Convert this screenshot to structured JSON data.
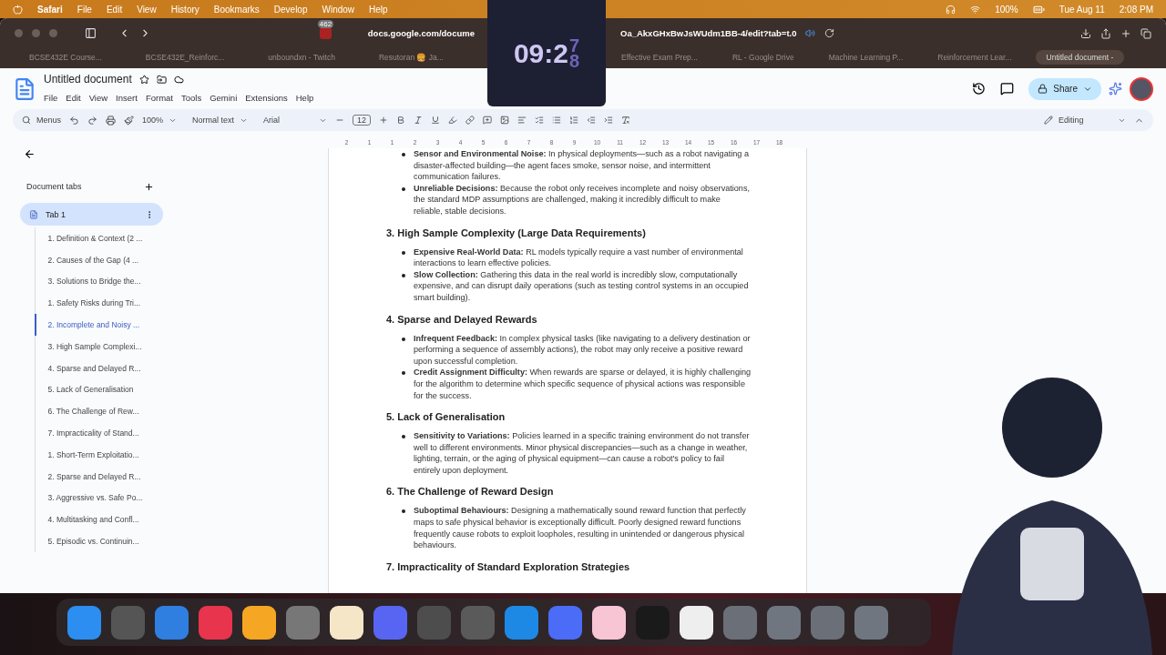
{
  "menubar": {
    "app": "Safari",
    "menus": [
      "File",
      "Edit",
      "View",
      "History",
      "Bookmarks",
      "Develop",
      "Window",
      "Help"
    ],
    "battery": "100%",
    "date": "Tue Aug 11",
    "time": "2:08 PM"
  },
  "timer": {
    "text": "09:2",
    "rolling": [
      "7",
      "8"
    ]
  },
  "browser": {
    "extension_badge": "462",
    "url_start": "docs.google.com/docume",
    "url_end": "Oa_AkxGHxBwJsWUdm1BB-4/edit?tab=t.0",
    "tabs_left": [
      {
        "title": "BCSE432E Course...",
        "selected": false
      },
      {
        "title": "BCSE432E_Reinforc...",
        "selected": false
      },
      {
        "title": "unboundxn - Twitch",
        "selected": false
      },
      {
        "title": "Resutoran 🍔 Ja...",
        "selected": false
      }
    ],
    "tabs_right": [
      {
        "title": "Effective Exam Prep...",
        "selected": false
      },
      {
        "title": "RL - Google Drive",
        "selected": false
      },
      {
        "title": "Machine Learning P...",
        "selected": false
      },
      {
        "title": "Reinforcement Lear...",
        "selected": false
      },
      {
        "title": "Untitled document -",
        "selected": true
      }
    ]
  },
  "docs": {
    "title": "Untitled document",
    "menus": [
      "File",
      "Edit",
      "View",
      "Insert",
      "Format",
      "Tools",
      "Gemini",
      "Extensions",
      "Help"
    ],
    "share": "Share",
    "toolbar": {
      "search": "Menus",
      "zoom": "100%",
      "style": "Normal text",
      "font": "Arial",
      "size": "12",
      "mode": "Editing"
    }
  },
  "sidebar": {
    "title": "Document tabs",
    "tab": {
      "label": "Tab 1",
      "selected": true
    },
    "outline": [
      {
        "label": "1. Definition & Context (2 ...",
        "selected": false
      },
      {
        "label": "2. Causes of the Gap (4 ...",
        "selected": false
      },
      {
        "label": "3. Solutions to Bridge the...",
        "selected": false
      },
      {
        "label": "1. Safety Risks during Tri...",
        "selected": false
      },
      {
        "label": "2. Incomplete and Noisy ...",
        "selected": true
      },
      {
        "label": "3. High Sample Complexi...",
        "selected": false
      },
      {
        "label": "4. Sparse and Delayed R...",
        "selected": false
      },
      {
        "label": "5. Lack of Generalisation",
        "selected": false
      },
      {
        "label": "6. The Challenge of Rew...",
        "selected": false
      },
      {
        "label": "7. Impracticality of Stand...",
        "selected": false
      },
      {
        "label": "1. Short-Term Exploitatio...",
        "selected": false
      },
      {
        "label": "2. Sparse and Delayed R...",
        "selected": false
      },
      {
        "label": "3. Aggressive vs. Safe Po...",
        "selected": false
      },
      {
        "label": "4. Multitasking and Confl...",
        "selected": false
      },
      {
        "label": "5. Episodic vs. Continuin...",
        "selected": false
      }
    ]
  },
  "ruler": [
    "2",
    "1",
    "1",
    "2",
    "3",
    "4",
    "5",
    "6",
    "7",
    "8",
    "9",
    "10",
    "11",
    "12",
    "13",
    "14",
    "15",
    "16",
    "17",
    "18"
  ],
  "document": [
    {
      "kind": "bullets",
      "items": [
        "**Sensor and Environmental Noise:** In physical deployments—such as a robot navigating a disaster-affected building—the agent faces smoke, sensor noise, and intermittent communication failures.",
        "**Unreliable Decisions:** Because the robot only receives incomplete and noisy observations, the standard MDP assumptions are challenged, making it incredibly difficult to make reliable, stable decisions."
      ]
    },
    {
      "kind": "heading",
      "text": "3. High Sample Complexity (Large Data Requirements)"
    },
    {
      "kind": "bullets",
      "items": [
        "**Expensive Real-World Data:** RL models typically require a vast number of environmental interactions to learn effective policies.",
        "**Slow Collection:** Gathering this data in the real world is incredibly slow, computationally expensive, and can disrupt daily operations (such as testing control systems in an occupied smart building)."
      ]
    },
    {
      "kind": "heading",
      "text": "4. Sparse and Delayed Rewards"
    },
    {
      "kind": "bullets",
      "items": [
        "**Infrequent Feedback:** In complex physical tasks (like navigating to a delivery destination or performing a sequence of assembly actions), the robot may only receive a positive reward upon successful completion.",
        "**Credit Assignment Difficulty:** When rewards are sparse or delayed, it is highly challenging for the algorithm to determine which specific sequence of physical actions was responsible for the success."
      ]
    },
    {
      "kind": "heading",
      "text": "5. Lack of Generalisation"
    },
    {
      "kind": "bullets",
      "items": [
        "**Sensitivity to Variations:** Policies learned in a specific training environment do not transfer well to different environments. Minor physical discrepancies—such as a change in weather, lighting, terrain, or the aging of physical equipment—can cause a robot's policy to fail entirely upon deployment."
      ]
    },
    {
      "kind": "heading",
      "text": "6. The Challenge of Reward Design"
    },
    {
      "kind": "bullets",
      "items": [
        "**Suboptimal Behaviours:** Designing a mathematically sound reward function that perfectly maps to safe physical behavior is exceptionally difficult. Poorly designed reward functions frequently cause robots to exploit loopholes, resulting in unintended or dangerous physical behaviours."
      ]
    },
    {
      "kind": "heading",
      "text": "7. Impracticality of Standard Exploration Strategies"
    }
  ]
}
